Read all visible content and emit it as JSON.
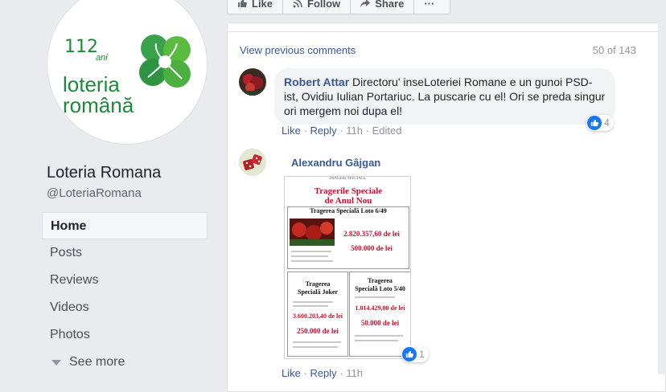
{
  "logo": {
    "number": "112",
    "ani": "ani",
    "line1": "loteria",
    "line2": "română"
  },
  "page": {
    "name": "Loteria Romana",
    "handle": "@LoteriaRomana"
  },
  "nav": [
    {
      "label": "Home",
      "active": true
    },
    {
      "label": "Posts"
    },
    {
      "label": "Reviews"
    },
    {
      "label": "Videos"
    },
    {
      "label": "Photos"
    }
  ],
  "see_more": "See more",
  "actions": {
    "like": "Like",
    "follow": "Follow",
    "share": "Share",
    "more": "···"
  },
  "comments_header": {
    "view_previous": "View previous comments",
    "count": "50 of 143"
  },
  "comment1": {
    "author": "Robert Attar",
    "text": "Directoru' inseLoteriei Romane e un gunoi PSD-ist, Ovidiu Iulian Portariuc. La puscarie cu el! Ori se preda singur ori mergem noi dupa el!",
    "like": "Like",
    "reply": "Reply",
    "time": "11h",
    "edited": "Edited",
    "reactions": "4"
  },
  "comment2": {
    "author": "Alexandru Gâjgan",
    "reactions": "1",
    "like": "Like",
    "reply": "Reply",
    "time": "11h",
    "poster": {
      "header": "TRAGERI SPECIALE",
      "title1": "Tragerile Speciale",
      "title2": "de Anul Nou",
      "loto649": "Tragerea Specială Loto 6/49",
      "amt649_1": "2.820.357,60 de lei",
      "amt649_2": "500.000 de lei",
      "joker1": "Tragerea",
      "joker2": "Specială Joker",
      "jokeramt1": "3.600.203,40 de lei",
      "jokeramt2": "250.000 de lei",
      "loto540a": "Tragerea",
      "loto540b": "Specială Loto 5/40",
      "amt540_1": "1.014.429,00 de lei",
      "amt540_2": "50.000 de lei"
    }
  },
  "colors": {
    "link": "#385898",
    "brand_green": "#1d8a3a",
    "like_blue": "#1877f2",
    "poster_red": "#c8102e"
  }
}
